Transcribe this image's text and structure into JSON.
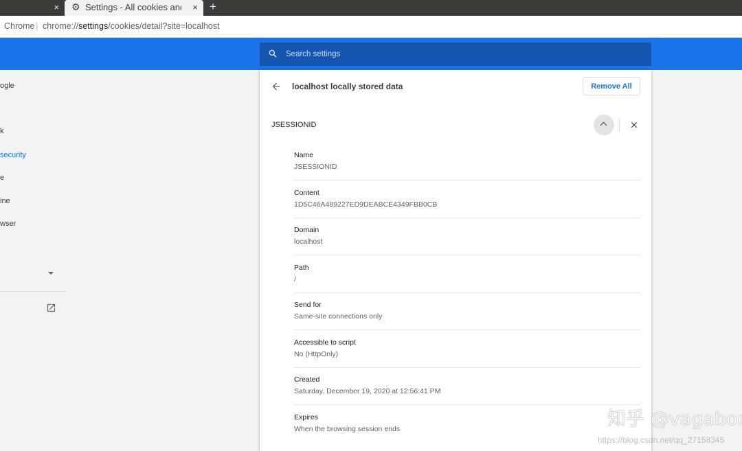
{
  "tabs": {
    "previous_close": "×",
    "active_title": "Settings - All cookies and site data",
    "active_close": "×",
    "new_tab": "+"
  },
  "address_bar": {
    "origin_label": "Chrome",
    "separator": "|",
    "url_scheme": "chrome://",
    "url_host": "settings",
    "url_path": "/cookies/detail?site=localhost"
  },
  "search": {
    "placeholder": "Search settings"
  },
  "left_nav": {
    "items": [
      {
        "label": "ogle",
        "active": false
      },
      {
        "label": "k",
        "active": false
      },
      {
        "label": " security",
        "active": true
      },
      {
        "label": "e",
        "active": false
      },
      {
        "label": "ine",
        "active": false
      },
      {
        "label": "wser",
        "active": false
      }
    ]
  },
  "card": {
    "title": "localhost locally stored data",
    "remove_all_label": "Remove All",
    "cookie_name": "JSESSIONID",
    "details": [
      {
        "label": "Name",
        "value": "JSESSIONID"
      },
      {
        "label": "Content",
        "value": "1D5C46A489227ED9DEABCE4349FBB0CB"
      },
      {
        "label": "Domain",
        "value": "localhost"
      },
      {
        "label": "Path",
        "value": "/"
      },
      {
        "label": "Send for",
        "value": "Same-site connections only"
      },
      {
        "label": "Accessible to script",
        "value": "No (HttpOnly)"
      },
      {
        "label": "Created",
        "value": "Saturday, December 19, 2020 at 12:56:41 PM"
      },
      {
        "label": "Expires",
        "value": "When the browsing session ends"
      }
    ]
  },
  "watermark": {
    "main": "知乎 @vagabond",
    "sub": "https://blog.csdn.net/qq_27158345"
  },
  "colors": {
    "accent": "#1a73e8",
    "search_bg": "#1557b0",
    "tabstrip": "#3c3b37"
  }
}
